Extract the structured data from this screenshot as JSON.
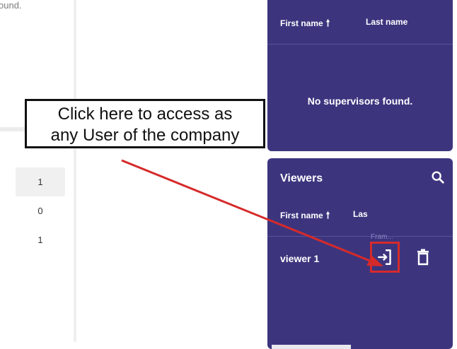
{
  "left": {
    "not_found_fragment": "ound.",
    "counts": [
      "1",
      "0",
      "1"
    ]
  },
  "supervisors_panel": {
    "col_first": "First name",
    "col_last": "Last name",
    "sort_arrow": "🠕",
    "empty_message": "No supervisors found."
  },
  "viewers_panel": {
    "title": "Viewers",
    "col_first": "First name",
    "col_last_partial": "Las",
    "sort_arrow": "🠕",
    "tooltip_partial": "Fram...",
    "rows": [
      {
        "name": "viewer 1"
      }
    ]
  },
  "callout": {
    "line1": "Click here to access as",
    "line2": "any User of the company"
  },
  "colors": {
    "panel_bg": "#3c357e",
    "highlight_red": "#d62a2a"
  },
  "icons": {
    "search": "search-icon",
    "login": "login-icon",
    "delete": "trash-icon"
  }
}
